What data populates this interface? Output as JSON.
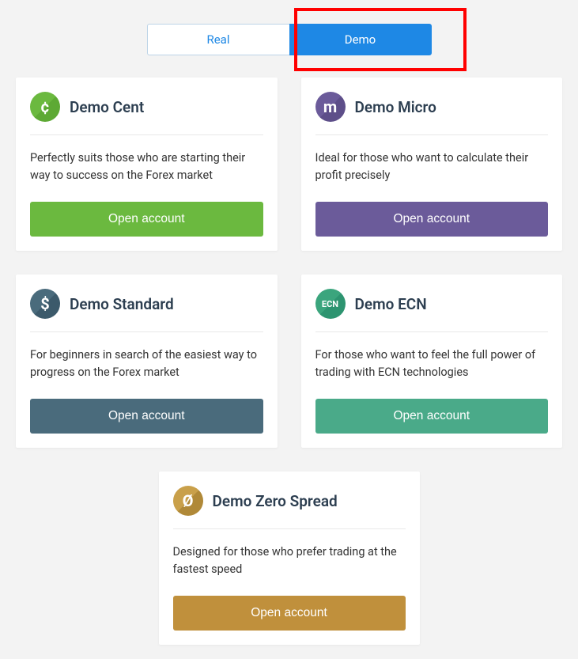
{
  "tabs": {
    "real": "Real",
    "demo": "Demo"
  },
  "accounts": {
    "cent": {
      "title": "Demo Cent",
      "icon_letter": "¢",
      "desc": "Perfectly suits those who are starting their way to success on the Forex market",
      "button": "Open account",
      "color": "#6bb93f"
    },
    "micro": {
      "title": "Demo Micro",
      "icon_letter": "m",
      "desc": "Ideal for those who want to calculate their profit precisely",
      "button": "Open account",
      "color": "#6b5b9a"
    },
    "standard": {
      "title": "Demo Standard",
      "icon_letter": "$",
      "desc": "For beginners in search of the easiest way to progress on the Forex market",
      "button": "Open account",
      "color": "#4a6b7c"
    },
    "ecn": {
      "title": "Demo ECN",
      "icon_letter": "ECN",
      "desc": "For those who want to feel the full power of trading with ECN technologies",
      "button": "Open account",
      "color": "#4aaa89"
    },
    "zero": {
      "title": "Demo Zero Spread",
      "icon_letter": "Ø",
      "desc": "Designed for those who prefer trading at the fastest speed",
      "button": "Open account",
      "color": "#c0903c"
    }
  }
}
